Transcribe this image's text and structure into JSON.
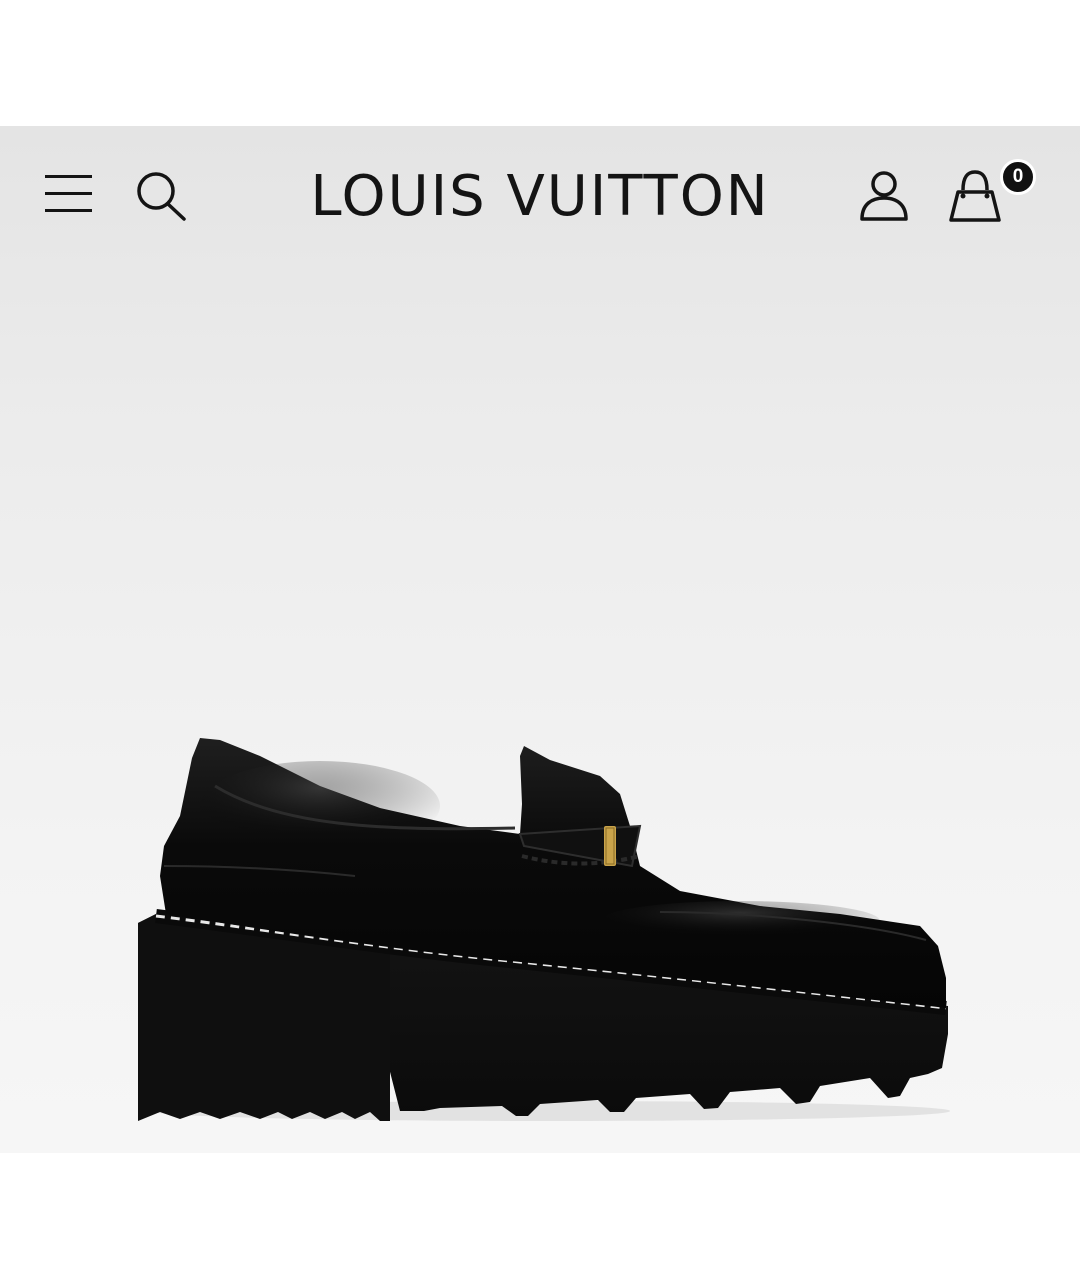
{
  "header": {
    "brand": "LOUIS VUITTON",
    "menu_icon": "hamburger-menu-icon",
    "search_icon": "search-icon",
    "account_icon": "account-icon",
    "bag_icon": "shopping-bag-icon",
    "bag_count": "0"
  },
  "product": {
    "image": "black-leather-loafer-platform-heel"
  },
  "colors": {
    "hero_background": "#ebebeb",
    "icon": "#141414",
    "badge": "#111111"
  }
}
